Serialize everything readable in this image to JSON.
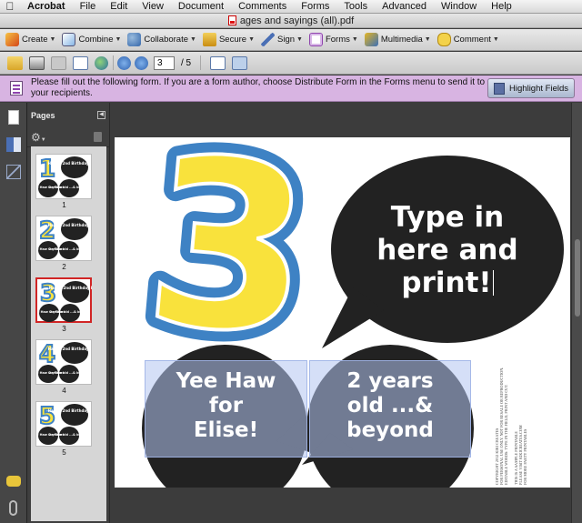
{
  "menubar": {
    "items": [
      "Acrobat",
      "File",
      "Edit",
      "View",
      "Document",
      "Comments",
      "Forms",
      "Tools",
      "Advanced",
      "Window",
      "Help"
    ]
  },
  "window": {
    "title": "ages and sayings (all).pdf"
  },
  "tasks": {
    "create": "Create",
    "combine": "Combine",
    "collaborate": "Collaborate",
    "secure": "Secure",
    "sign": "Sign",
    "forms": "Forms",
    "multimedia": "Multimedia",
    "comment": "Comment"
  },
  "nav": {
    "current_page": "3",
    "total_pages": "/ 5"
  },
  "formbar": {
    "message": "Please fill out the following form. If you are a form author, choose Distribute Form in the Forms menu to send it to your recipients.",
    "highlight_label": "Highlight Fields"
  },
  "pages_panel": {
    "title": "Pages",
    "thumbnails": [
      {
        "number": "1",
        "digit": "1",
        "headline": "Happy 2nd Birthday Elise!",
        "left": "Yee Haw for Elise!",
        "right": "2 years old ...& beyond"
      },
      {
        "number": "2",
        "digit": "2",
        "headline": "Happy 2nd Birthday Elise!",
        "left": "Yee Haw for Elise!",
        "right": "2 years old ...& beyond"
      },
      {
        "number": "3",
        "digit": "3",
        "headline": "Happy 2nd Birthday Elise!",
        "left": "Yee Haw for Elise!",
        "right": "2 years old ...& beyond"
      },
      {
        "number": "4",
        "digit": "4",
        "headline": "Happy 2nd Birthday Elise!",
        "left": "Yee Haw for Elise!",
        "right": "2 years old ...& beyond"
      },
      {
        "number": "5",
        "digit": "5",
        "headline": "Happy 2nd Birthday Elise!",
        "left": "Yee Haw for Elise!",
        "right": "2 years old ...& beyond"
      }
    ]
  },
  "document": {
    "big_digit": "3",
    "main_bubble": {
      "line1": "Type in",
      "line2": "here and",
      "line3": "print!"
    },
    "field_left": {
      "line1": "Yee Haw",
      "line2": "for",
      "line3": "Elise!"
    },
    "field_right": {
      "line1": "2 years",
      "line2": "old ...&",
      "line3": "beyond"
    },
    "copyright_lines": [
      "COPYRIGHT 2012 KIKI CREATES",
      "FOR PERSONAL USE ONLY. NOT FOR RESALE OR REPRODUCTION.",
      "EDITABLE WORDS: TYPE IN THE FIELD, PRINT AND CUT.",
      "",
      "THIS IS A SAMPLE PRINTABLE",
      "PLEASE VISIT KIKICREATES.COM",
      "FOR MORE PARTY PRINTABLES"
    ]
  },
  "colors": {
    "digit_fill": "#f9e23c",
    "digit_outline": "#3e82c4",
    "bubble": "#222222",
    "form_bar": "#d8b4e2"
  }
}
